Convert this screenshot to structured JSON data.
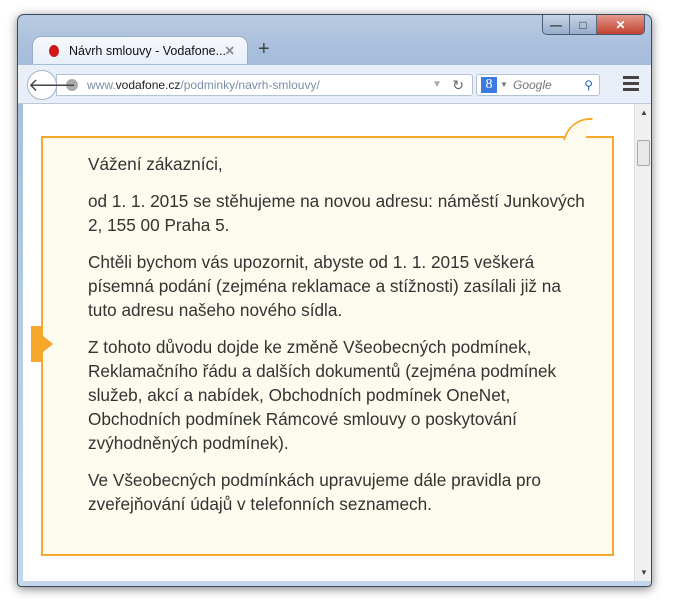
{
  "browser": {
    "tab_title": "Návrh smlouvy - Vodafone...",
    "url_prefix": "www.",
    "url_domain": "vodafone.cz",
    "url_path": "/podminky/navrh-smlouvy/",
    "search_placeholder": "Google",
    "search_engine_letter": "8"
  },
  "content": {
    "paragraphs": [
      "Vážení zákazníci,",
      "od 1. 1. 2015 se stěhujeme na novou adresu: náměstí Junkových 2, 155 00 Praha 5.",
      "Chtěli bychom vás upozornit, abyste od 1. 1. 2015 veškerá písemná podání (zejména reklamace a stížnosti) zasílali již na tuto adresu našeho nového sídla.",
      "Z tohoto důvodu dojde ke změně Všeobecných podmínek, Reklamačního řádu a dalších dokumentů (zejména podmínek služeb, akcí a nabídek, Obchodních podmínek OneNet, Obchodních podmínek Rámcové smlouvy o poskytování zvýhodněných podmínek).",
      "Ve Všeobecných podmínkách upravujeme dále pravidla pro zveřejňování údajů v telefonních seznamech."
    ]
  },
  "colors": {
    "accent": "#f5a82b",
    "box_bg": "#fdfbee"
  }
}
